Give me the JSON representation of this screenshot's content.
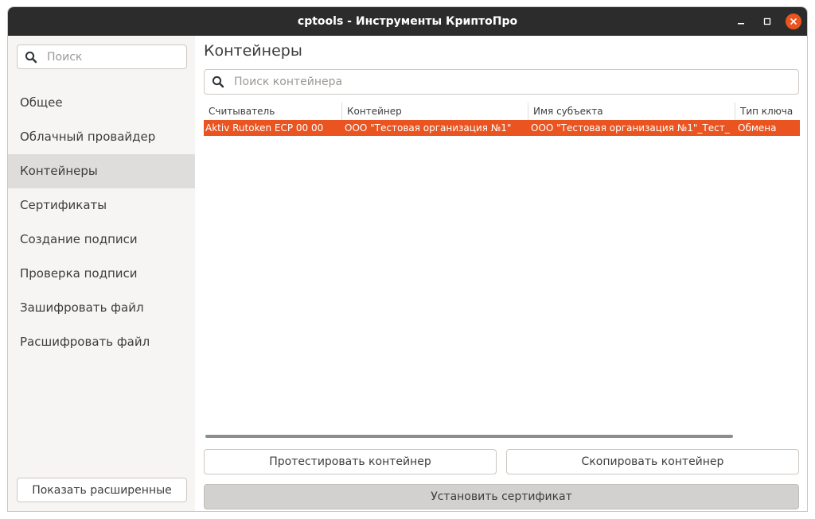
{
  "window": {
    "title": "cptools - Инструменты КриптоПро"
  },
  "sidebar": {
    "search_placeholder": "Поиск",
    "items": [
      {
        "label": "Общее"
      },
      {
        "label": "Облачный провайдер"
      },
      {
        "label": "Контейнеры"
      },
      {
        "label": "Сертификаты"
      },
      {
        "label": "Создание подписи"
      },
      {
        "label": "Проверка подписи"
      },
      {
        "label": "Зашифровать файл"
      },
      {
        "label": "Расшифровать файл"
      }
    ],
    "selected_index": 2,
    "show_advanced_label": "Показать расширенные"
  },
  "content": {
    "title": "Контейнеры",
    "search_placeholder": "Поиск контейнера",
    "table": {
      "columns": [
        "Считыватель",
        "Контейнер",
        "Имя субъекта",
        "Тип ключа"
      ],
      "rows": [
        [
          "Aktiv Rutoken ECP 00 00",
          "ООО \"Тестовая организация №1\"",
          "ООО \"Тестовая организация №1\"_Тест_",
          "Обмена"
        ]
      ]
    },
    "buttons": {
      "test": "Протестировать контейнер",
      "copy": "Скопировать контейнер",
      "install": "Установить сертификат"
    }
  },
  "colors": {
    "accent": "#e95420",
    "titlebar": "#2c2c2c",
    "sidebar_bg": "#f6f5f4",
    "selected_nav": "#dedddc"
  },
  "icons": {
    "search": "search-icon",
    "minimize": "minimize-icon",
    "maximize": "maximize-icon",
    "close": "close-icon"
  }
}
